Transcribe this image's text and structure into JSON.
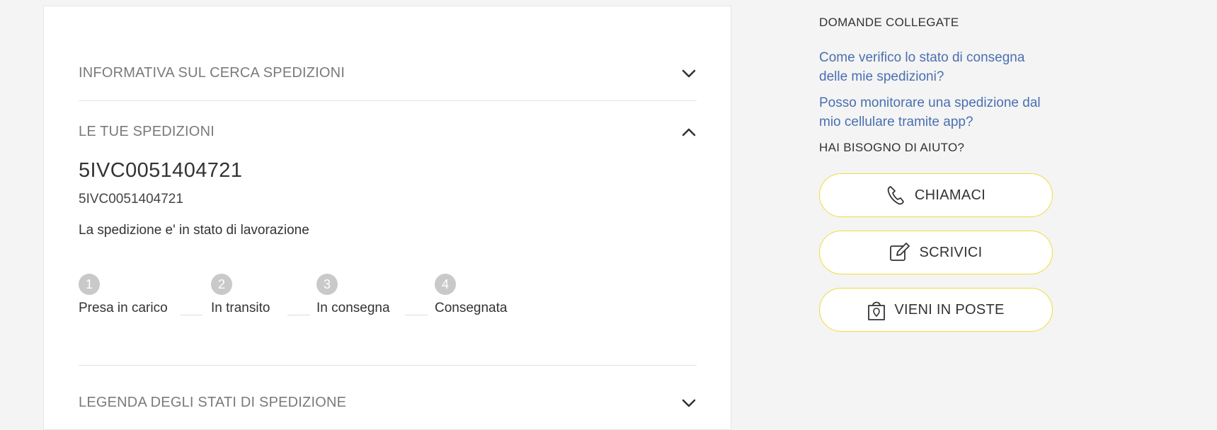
{
  "accordion": {
    "info_title": "INFORMATIVA SUL CERCA SPEDIZIONI",
    "yours_title": "LE TUE SPEDIZIONI",
    "legend_title": "LEGENDA DEGLI STATI DI SPEDIZIONE"
  },
  "shipment": {
    "code_big": "5IVC0051404721",
    "code_small": "5IVC0051404721",
    "status": "La spedizione e' in stato di lavorazione",
    "steps": [
      {
        "num": "1",
        "label": "Presa in carico"
      },
      {
        "num": "2",
        "label": "In transito"
      },
      {
        "num": "3",
        "label": "In consegna"
      },
      {
        "num": "4",
        "label": "Consegnata"
      }
    ]
  },
  "sidebar": {
    "related_title": "DOMANDE COLLEGATE",
    "links": [
      "Come verifico lo stato di consegna delle mie spedizioni?",
      "Posso monitorare una spedizione dal mio cellulare tramite app?"
    ],
    "help_title": "HAI BISOGNO DI AIUTO?",
    "buttons": [
      {
        "label": "CHIAMACI",
        "icon": "phone-icon"
      },
      {
        "label": "SCRIVICI",
        "icon": "edit-icon"
      },
      {
        "label": "VIENI IN POSTE",
        "icon": "location-bag-icon"
      }
    ]
  },
  "colors": {
    "link": "#4a6fb1",
    "pill_border": "#f0dc3a",
    "step_circle": "#c9c9c9",
    "background": "#f4f4f4"
  }
}
